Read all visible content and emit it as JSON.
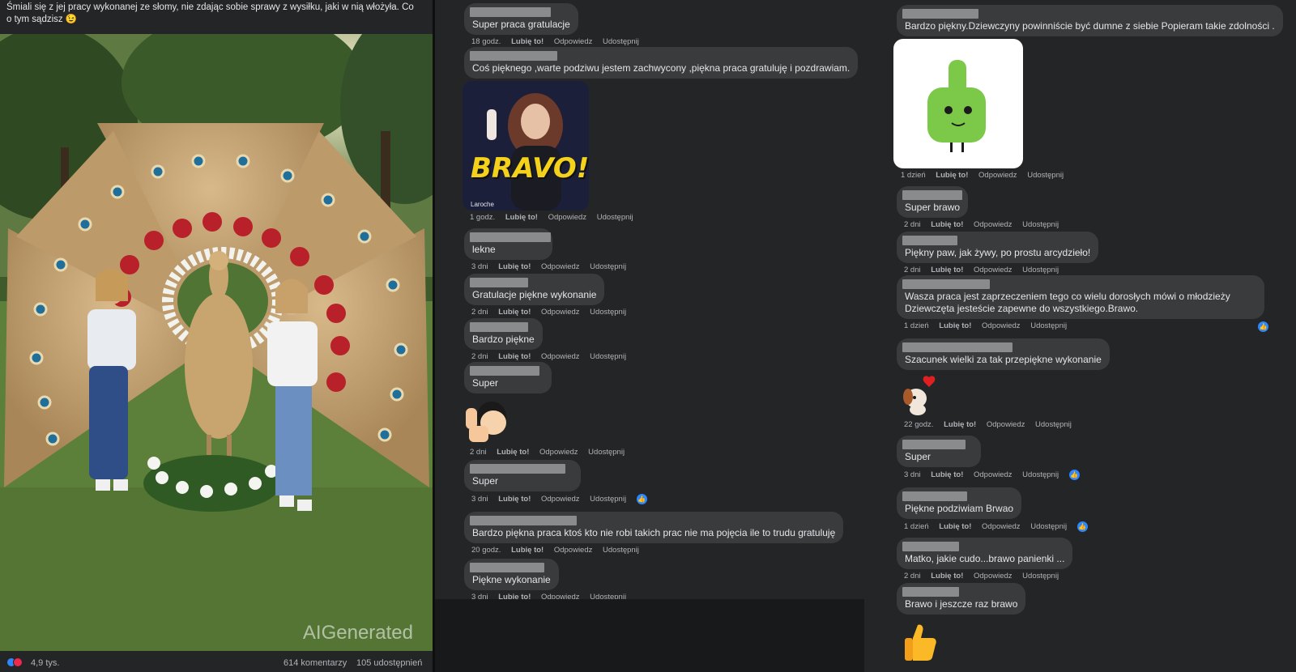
{
  "post": {
    "caption": "Śmiali się z jej pracy wykonanej ze słomy, nie zdając sobie sprawy z wysiłku, jaki w nią włożyła. Co o tym sądzisz 😉",
    "watermark": "AIGenerated",
    "reaction_count": "4,9 tys.",
    "comment_count": "614 komentarzy",
    "share_count": "105 udostępnień"
  },
  "actions": {
    "like": "Lubię to!",
    "reply": "Odpowiedz",
    "share": "Udostępnij"
  },
  "comments_mid": [
    {
      "text": "Super praca gratulacje",
      "time": "18 godz."
    },
    {
      "text": "Coś pięknego ,warte podziwu jestem zachwycony ,piękna praca gratuluję i pozdrawiam.",
      "time": ""
    },
    {
      "gif_text": "BRAVO!",
      "gif_source": "Laroche",
      "time": "1 godz."
    },
    {
      "text": "lekne",
      "time": "3 dni"
    },
    {
      "text": "Gratulacje piękne wykonanie",
      "time": "2 dni"
    },
    {
      "text": "Bardzo piękne",
      "time": "2 dni"
    },
    {
      "text": "Super",
      "time": "2 dni"
    },
    {
      "text": "Super",
      "time": "3 dni"
    },
    {
      "text": "Bardzo piękna praca ktoś kto nie robi takich prac nie ma pojęcia ile to trudu gratuluję",
      "time": "20 godz."
    },
    {
      "text": "Piękne wykonanie",
      "time": "3 dni"
    }
  ],
  "comments_right": [
    {
      "text": "Bardzo piękny.Dziewczyny powinniście być dumne z siebie Popieram takie zdolności .",
      "time": ""
    },
    {
      "sticker": "green-thumbs-up",
      "time": "1 dzień"
    },
    {
      "text": "Super brawo",
      "time": "2 dni"
    },
    {
      "text": "Piękny paw, jak żywy, po prostu arcydzieło!",
      "time": "2 dni"
    },
    {
      "text": "Wasza praca jest zaprzeczeniem tego co wielu dorosłych mówi o młodzieży Dziewczęta jesteście zapewne do wszystkiego.Brawo.",
      "time": "1 dzień"
    },
    {
      "text": "Szacunek wielki za tak przepiękne wykonanie",
      "time": ""
    },
    {
      "sticker": "puppy-heart",
      "time": "22 godz."
    },
    {
      "text": "Super",
      "time": "3 dni"
    },
    {
      "text": "Piękne podziwiam Brwao",
      "time": "1 dzień"
    },
    {
      "text": "Matko, jakie cudo...brawo panienki ...",
      "time": "2 dni"
    },
    {
      "text": "Brawo i jeszcze raz brawo",
      "time": ""
    }
  ],
  "colors": {
    "panel": "#242526",
    "bubble": "#3a3b3c",
    "accent": "#2d88ff",
    "text": "#e4e6eb",
    "muted": "#b0b3b8"
  }
}
